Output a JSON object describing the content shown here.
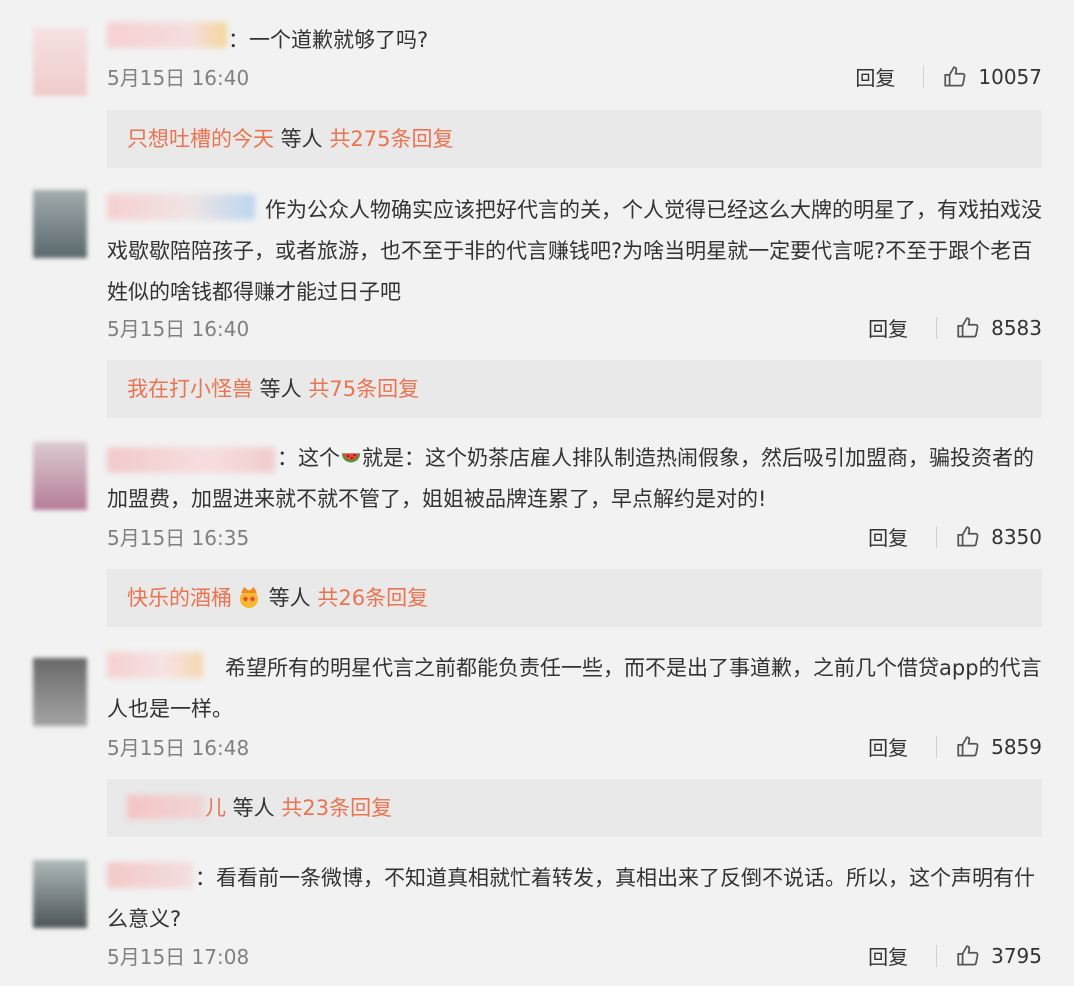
{
  "comments": [
    {
      "text": "：一个道歉就够了吗?",
      "time": "5月15日 16:40",
      "reply_label": "回复",
      "likes": "10057",
      "replies": {
        "users": "只想吐槽的今天",
        "mid": " 等人 ",
        "total": "共275条回复"
      }
    },
    {
      "text": "作为公众人物确实应该把好代言的关，个人觉得已经这么大牌的明星了，有戏拍戏没戏歇歇陪陪孩子，或者旅游，也不至于非的代言赚钱吧?为啥当明星就一定要代言呢?不至于跟个老百姓似的啥钱都得赚才能过日子吧",
      "time": "5月15日 16:40",
      "reply_label": "回复",
      "likes": "8583",
      "replies": {
        "users": "我在打小怪兽",
        "mid": " 等人 ",
        "total": "共75条回复"
      }
    },
    {
      "text_a": "：这个",
      "text_b": "就是：这个奶茶店雇人排队制造热闹假象，然后吸引加盟商，骗投资者的加盟费，加盟进来就不就不管了，姐姐被品牌连累了，早点解约是对的!",
      "time": "5月15日 16:35",
      "reply_label": "回复",
      "likes": "8350",
      "replies": {
        "users": "快乐的酒桶",
        "mid": " 等人 ",
        "total": "共26条回复"
      }
    },
    {
      "text": "希望所有的明星代言之前都能负责任一些，而不是出了事道歉，之前几个借贷app的代言人也是一样。",
      "time": "5月15日 16:48",
      "reply_label": "回复",
      "likes": "5859",
      "replies": {
        "users": "儿",
        "mid": " 等人 ",
        "total": "共23条回复"
      }
    },
    {
      "text": "：看看前一条微博，不知道真相就忙着转发，真相出来了反倒不说话。所以，这个声明有什么意义?",
      "time": "5月15日 17:08",
      "reply_label": "回复",
      "likes": "3795"
    }
  ],
  "colors": {
    "accent": "#eb7350",
    "background": "#f2f2f2",
    "reply_box": "#e9e9e9"
  },
  "icons": {
    "like": "thumbs-up-icon",
    "melon": "watermelon-emoji",
    "crown": "crown-emoji"
  }
}
